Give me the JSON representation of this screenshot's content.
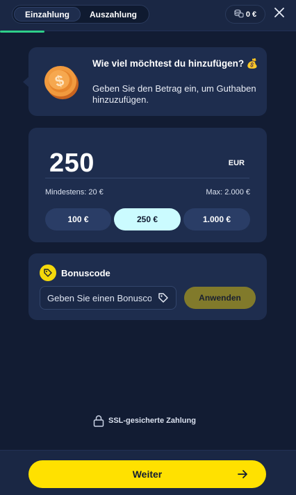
{
  "header": {
    "tabs": [
      {
        "label": "Einzahlung",
        "active": true
      },
      {
        "label": "Auszahlung",
        "active": false
      }
    ],
    "balance": "0 €",
    "balance_icon": "coins-icon",
    "close_icon": "close-icon",
    "progress_fraction": 0.15,
    "progress_color": "#2fcf8a"
  },
  "info": {
    "title": "Wie viel möchtest du hinzufügen? 💰",
    "description": "Geben Sie den Betrag ein, um Guthaben hinzuzufügen.",
    "icon": "coin-icon"
  },
  "amount": {
    "value": "250",
    "currency": "EUR",
    "min_label": "Mindestens: 20 €",
    "max_label": "Max: 2.000 €",
    "presets": [
      {
        "label": "100 €",
        "selected": false
      },
      {
        "label": "250 €",
        "selected": true
      },
      {
        "label": "1.000 €",
        "selected": false
      }
    ]
  },
  "bonus": {
    "label": "Bonuscode",
    "placeholder": "Geben Sie einen Bonuscode ein",
    "apply_label": "Anwenden",
    "icon": "tag-icon"
  },
  "ssl": {
    "label": "SSL-gesicherte Zahlung",
    "icon": "lock-icon"
  },
  "footer": {
    "continue_label": "Weiter",
    "arrow_icon": "arrow-right-icon"
  },
  "colors": {
    "background": "#121c33",
    "card": "#1e2d4e",
    "accent_yellow": "#ffe100",
    "selected_preset": "#cbfbff",
    "apply_button": "#817a2b"
  }
}
